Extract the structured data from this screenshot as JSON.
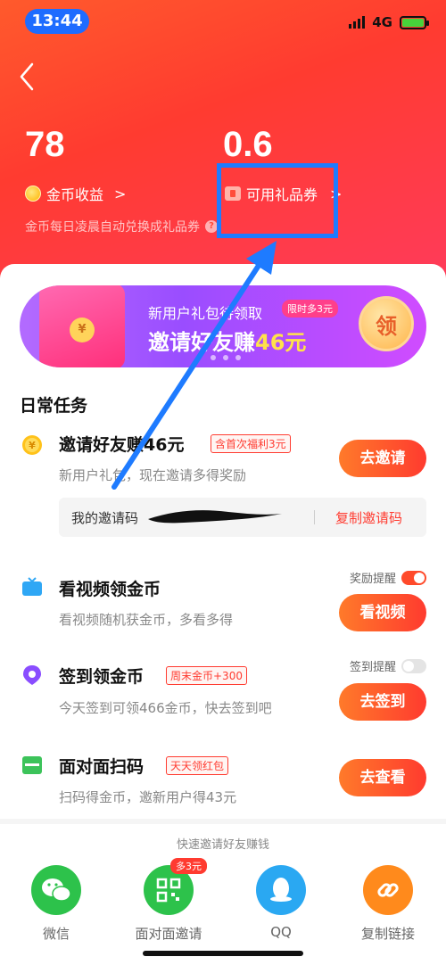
{
  "status": {
    "time": "13:44",
    "network": "4G"
  },
  "hero": {
    "coin_value": "78",
    "coin_label": "金币收益",
    "voucher_value": "0.6",
    "voucher_label": "可用礼品券",
    "chevron": ">",
    "hint": "金币每日凌晨自动兑换成礼品券",
    "colors": {
      "primary": "#ff3b30",
      "accent": "#ff7a2a"
    }
  },
  "banner": {
    "subtitle": "新用户礼包待领取",
    "tag": "限时多3元",
    "title_prefix": "邀请好友赚",
    "title_amount": "46元",
    "button": "领",
    "envelope_mark": "¥"
  },
  "section_title": "日常任务",
  "tasks": [
    {
      "title": "邀请好友赚46元",
      "badge": "含首次福利3元",
      "desc": "新用户礼包，现在邀请多得奖励",
      "button": "去邀请",
      "icon": "coin-icon"
    },
    {
      "title": "看视频领金币",
      "desc": "看视频随机获金币，多看多得",
      "button": "看视频",
      "remind": "奖励提醒",
      "remind_on": true,
      "icon": "tv-icon"
    },
    {
      "title": "签到领金币",
      "badge": "周末金币+300",
      "desc": "今天签到可领466金币，快去签到吧",
      "button": "去签到",
      "remind": "签到提醒",
      "remind_on": false,
      "icon": "location-pin-icon"
    },
    {
      "title": "面对面扫码",
      "badge": "天天领红包",
      "desc": "扫码得金币，邀新用户得43元",
      "button": "去查看",
      "icon": "scan-icon"
    }
  ],
  "invite_code": {
    "label": "我的邀请码",
    "copy": "复制邀请码"
  },
  "share": {
    "caption": "快速邀请好友赚钱",
    "items": [
      {
        "label": "微信",
        "icon": "wechat-icon",
        "color": "#2dc24b"
      },
      {
        "label": "面对面邀请",
        "icon": "qr-code-icon",
        "color": "#2dc24b",
        "badge": "多3元"
      },
      {
        "label": "QQ",
        "icon": "qq-icon",
        "color": "#2aa8f2"
      },
      {
        "label": "复制链接",
        "icon": "link-icon",
        "color": "#ff8a1c"
      }
    ]
  }
}
